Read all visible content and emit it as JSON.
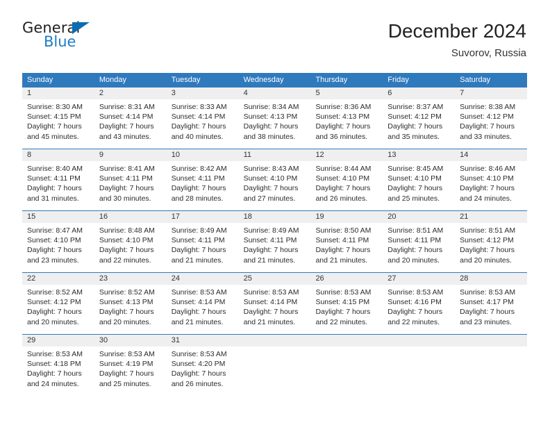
{
  "brand": {
    "name_part1": "General",
    "name_part2": "Blue",
    "triangle_color": "#0b6cb2",
    "blue_text_color": "#1f7cc4"
  },
  "header": {
    "title": "December 2024",
    "subtitle": "Suvorov, Russia"
  },
  "theme": {
    "header_blue": "#2f79bd",
    "daynum_band": "#efefef",
    "divider_blue": "#2f79bd"
  },
  "calendar": {
    "weekday_headers": [
      "Sunday",
      "Monday",
      "Tuesday",
      "Wednesday",
      "Thursday",
      "Friday",
      "Saturday"
    ],
    "weeks": [
      [
        {
          "day": "1",
          "sunrise": "Sunrise: 8:30 AM",
          "sunset": "Sunset: 4:15 PM",
          "daylight1": "Daylight: 7 hours",
          "daylight2": "and 45 minutes."
        },
        {
          "day": "2",
          "sunrise": "Sunrise: 8:31 AM",
          "sunset": "Sunset: 4:14 PM",
          "daylight1": "Daylight: 7 hours",
          "daylight2": "and 43 minutes."
        },
        {
          "day": "3",
          "sunrise": "Sunrise: 8:33 AM",
          "sunset": "Sunset: 4:14 PM",
          "daylight1": "Daylight: 7 hours",
          "daylight2": "and 40 minutes."
        },
        {
          "day": "4",
          "sunrise": "Sunrise: 8:34 AM",
          "sunset": "Sunset: 4:13 PM",
          "daylight1": "Daylight: 7 hours",
          "daylight2": "and 38 minutes."
        },
        {
          "day": "5",
          "sunrise": "Sunrise: 8:36 AM",
          "sunset": "Sunset: 4:13 PM",
          "daylight1": "Daylight: 7 hours",
          "daylight2": "and 36 minutes."
        },
        {
          "day": "6",
          "sunrise": "Sunrise: 8:37 AM",
          "sunset": "Sunset: 4:12 PM",
          "daylight1": "Daylight: 7 hours",
          "daylight2": "and 35 minutes."
        },
        {
          "day": "7",
          "sunrise": "Sunrise: 8:38 AM",
          "sunset": "Sunset: 4:12 PM",
          "daylight1": "Daylight: 7 hours",
          "daylight2": "and 33 minutes."
        }
      ],
      [
        {
          "day": "8",
          "sunrise": "Sunrise: 8:40 AM",
          "sunset": "Sunset: 4:11 PM",
          "daylight1": "Daylight: 7 hours",
          "daylight2": "and 31 minutes."
        },
        {
          "day": "9",
          "sunrise": "Sunrise: 8:41 AM",
          "sunset": "Sunset: 4:11 PM",
          "daylight1": "Daylight: 7 hours",
          "daylight2": "and 30 minutes."
        },
        {
          "day": "10",
          "sunrise": "Sunrise: 8:42 AM",
          "sunset": "Sunset: 4:11 PM",
          "daylight1": "Daylight: 7 hours",
          "daylight2": "and 28 minutes."
        },
        {
          "day": "11",
          "sunrise": "Sunrise: 8:43 AM",
          "sunset": "Sunset: 4:10 PM",
          "daylight1": "Daylight: 7 hours",
          "daylight2": "and 27 minutes."
        },
        {
          "day": "12",
          "sunrise": "Sunrise: 8:44 AM",
          "sunset": "Sunset: 4:10 PM",
          "daylight1": "Daylight: 7 hours",
          "daylight2": "and 26 minutes."
        },
        {
          "day": "13",
          "sunrise": "Sunrise: 8:45 AM",
          "sunset": "Sunset: 4:10 PM",
          "daylight1": "Daylight: 7 hours",
          "daylight2": "and 25 minutes."
        },
        {
          "day": "14",
          "sunrise": "Sunrise: 8:46 AM",
          "sunset": "Sunset: 4:10 PM",
          "daylight1": "Daylight: 7 hours",
          "daylight2": "and 24 minutes."
        }
      ],
      [
        {
          "day": "15",
          "sunrise": "Sunrise: 8:47 AM",
          "sunset": "Sunset: 4:10 PM",
          "daylight1": "Daylight: 7 hours",
          "daylight2": "and 23 minutes."
        },
        {
          "day": "16",
          "sunrise": "Sunrise: 8:48 AM",
          "sunset": "Sunset: 4:10 PM",
          "daylight1": "Daylight: 7 hours",
          "daylight2": "and 22 minutes."
        },
        {
          "day": "17",
          "sunrise": "Sunrise: 8:49 AM",
          "sunset": "Sunset: 4:11 PM",
          "daylight1": "Daylight: 7 hours",
          "daylight2": "and 21 minutes."
        },
        {
          "day": "18",
          "sunrise": "Sunrise: 8:49 AM",
          "sunset": "Sunset: 4:11 PM",
          "daylight1": "Daylight: 7 hours",
          "daylight2": "and 21 minutes."
        },
        {
          "day": "19",
          "sunrise": "Sunrise: 8:50 AM",
          "sunset": "Sunset: 4:11 PM",
          "daylight1": "Daylight: 7 hours",
          "daylight2": "and 21 minutes."
        },
        {
          "day": "20",
          "sunrise": "Sunrise: 8:51 AM",
          "sunset": "Sunset: 4:11 PM",
          "daylight1": "Daylight: 7 hours",
          "daylight2": "and 20 minutes."
        },
        {
          "day": "21",
          "sunrise": "Sunrise: 8:51 AM",
          "sunset": "Sunset: 4:12 PM",
          "daylight1": "Daylight: 7 hours",
          "daylight2": "and 20 minutes."
        }
      ],
      [
        {
          "day": "22",
          "sunrise": "Sunrise: 8:52 AM",
          "sunset": "Sunset: 4:12 PM",
          "daylight1": "Daylight: 7 hours",
          "daylight2": "and 20 minutes."
        },
        {
          "day": "23",
          "sunrise": "Sunrise: 8:52 AM",
          "sunset": "Sunset: 4:13 PM",
          "daylight1": "Daylight: 7 hours",
          "daylight2": "and 20 minutes."
        },
        {
          "day": "24",
          "sunrise": "Sunrise: 8:53 AM",
          "sunset": "Sunset: 4:14 PM",
          "daylight1": "Daylight: 7 hours",
          "daylight2": "and 21 minutes."
        },
        {
          "day": "25",
          "sunrise": "Sunrise: 8:53 AM",
          "sunset": "Sunset: 4:14 PM",
          "daylight1": "Daylight: 7 hours",
          "daylight2": "and 21 minutes."
        },
        {
          "day": "26",
          "sunrise": "Sunrise: 8:53 AM",
          "sunset": "Sunset: 4:15 PM",
          "daylight1": "Daylight: 7 hours",
          "daylight2": "and 22 minutes."
        },
        {
          "day": "27",
          "sunrise": "Sunrise: 8:53 AM",
          "sunset": "Sunset: 4:16 PM",
          "daylight1": "Daylight: 7 hours",
          "daylight2": "and 22 minutes."
        },
        {
          "day": "28",
          "sunrise": "Sunrise: 8:53 AM",
          "sunset": "Sunset: 4:17 PM",
          "daylight1": "Daylight: 7 hours",
          "daylight2": "and 23 minutes."
        }
      ],
      [
        {
          "day": "29",
          "sunrise": "Sunrise: 8:53 AM",
          "sunset": "Sunset: 4:18 PM",
          "daylight1": "Daylight: 7 hours",
          "daylight2": "and 24 minutes."
        },
        {
          "day": "30",
          "sunrise": "Sunrise: 8:53 AM",
          "sunset": "Sunset: 4:19 PM",
          "daylight1": "Daylight: 7 hours",
          "daylight2": "and 25 minutes."
        },
        {
          "day": "31",
          "sunrise": "Sunrise: 8:53 AM",
          "sunset": "Sunset: 4:20 PM",
          "daylight1": "Daylight: 7 hours",
          "daylight2": "and 26 minutes."
        },
        {
          "day": "",
          "sunrise": "",
          "sunset": "",
          "daylight1": "",
          "daylight2": ""
        },
        {
          "day": "",
          "sunrise": "",
          "sunset": "",
          "daylight1": "",
          "daylight2": ""
        },
        {
          "day": "",
          "sunrise": "",
          "sunset": "",
          "daylight1": "",
          "daylight2": ""
        },
        {
          "day": "",
          "sunrise": "",
          "sunset": "",
          "daylight1": "",
          "daylight2": ""
        }
      ]
    ]
  }
}
